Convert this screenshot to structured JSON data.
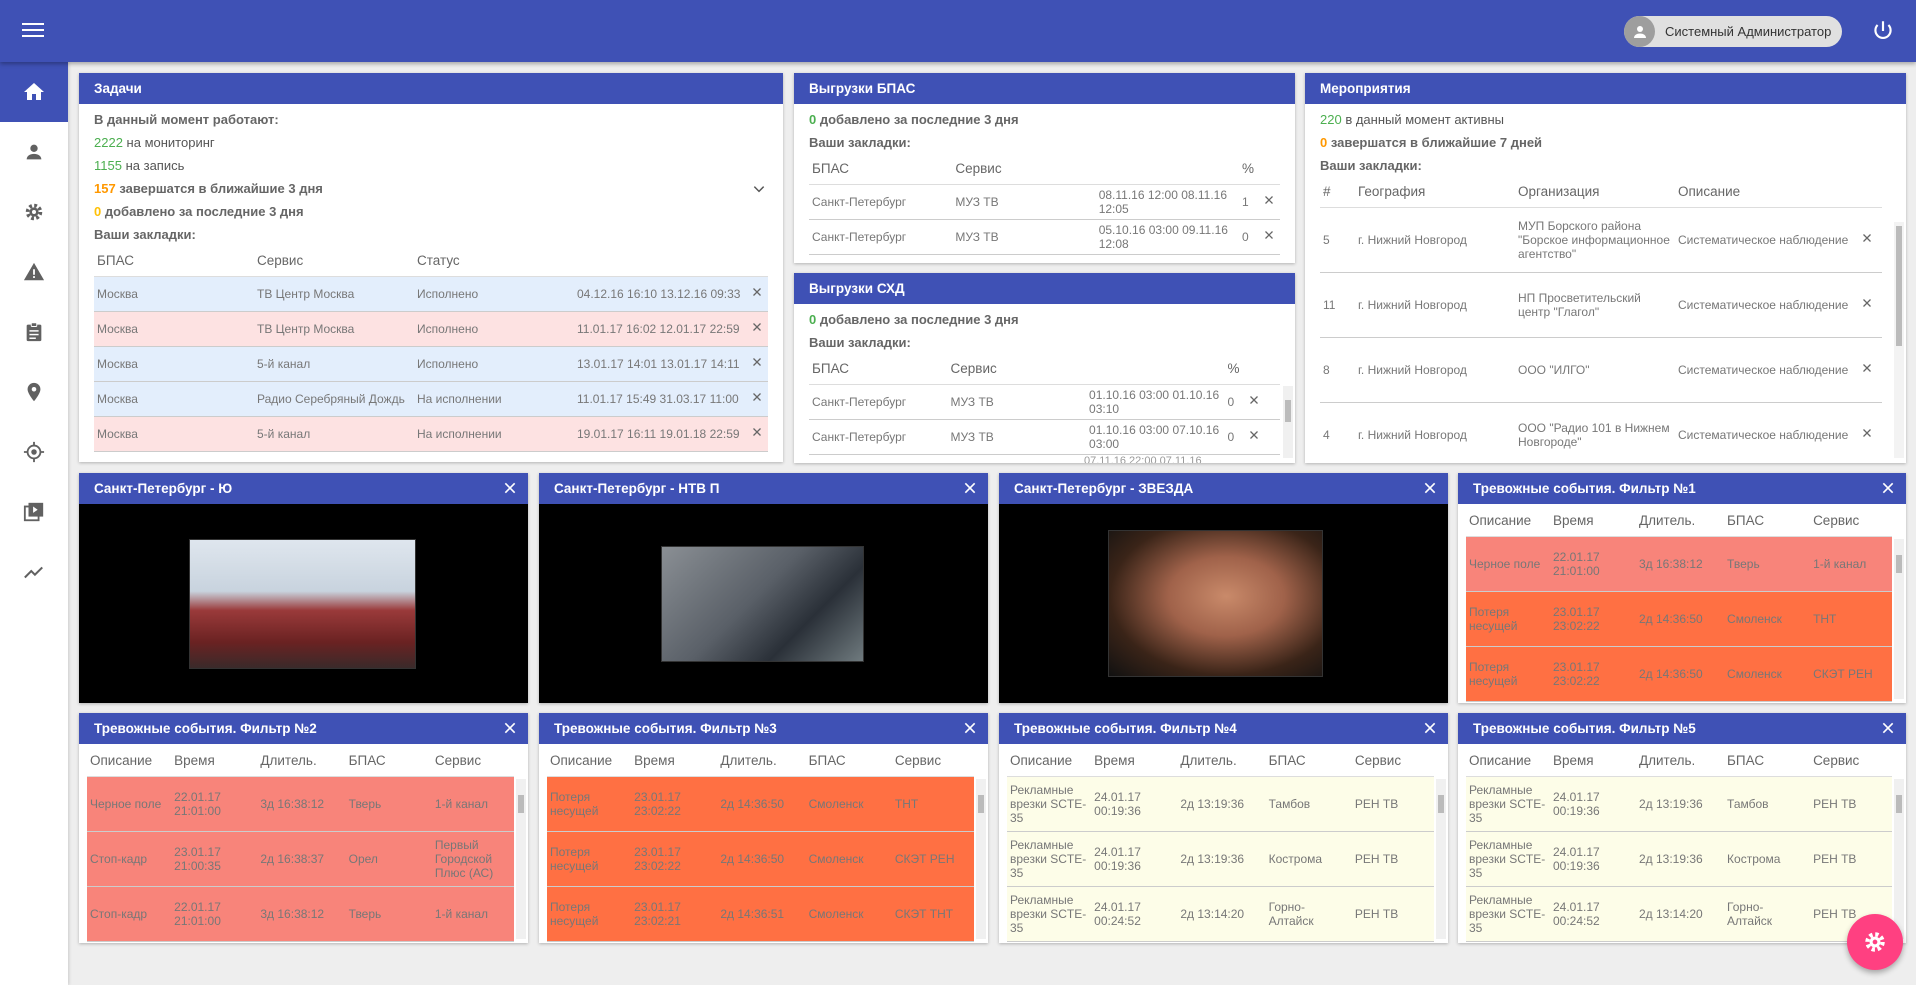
{
  "header": {
    "user_name": "Системный Администратор"
  },
  "sidebar": {
    "items": [
      "home-icon",
      "person-icon",
      "gear-icon",
      "warning-icon",
      "clipboard-icon",
      "location-icon",
      "target-icon",
      "video-icon",
      "trending-icon"
    ]
  },
  "tasks": {
    "title": "Задачи",
    "working_now": "В данный момент работают:",
    "monitoring_count": "2222",
    "monitoring_label": "на мониторинг",
    "record_count": "1155",
    "record_label": "на запись",
    "ending_count": "157",
    "ending_label": "завершатся в ближайшие 3 дня",
    "added_count": "0",
    "added_label": "добавлено за последние 3 дня",
    "bookmarks_label": "Ваши закладки:",
    "columns": [
      "БПАС",
      "Сервис",
      "Статус"
    ],
    "rows": [
      {
        "bpas": "Москва",
        "service": "ТВ Центр Москва",
        "status": "Исполнено",
        "dates": "04.12.16 16:10 13.12.16 09:33",
        "tone": "blue"
      },
      {
        "bpas": "Москва",
        "service": "ТВ Центр Москва",
        "status": "Исполнено",
        "dates": "11.01.17 16:02 12.01.17 22:59",
        "tone": "pink"
      },
      {
        "bpas": "Москва",
        "service": "5-й канал",
        "status": "Исполнено",
        "dates": "13.01.17 14:01 13.01.17 14:11",
        "tone": "blue"
      },
      {
        "bpas": "Москва",
        "service": "Радио Серебряный Дождь",
        "status": "На исполнении",
        "dates": "11.01.17 15:49 31.03.17 11:00",
        "tone": "blue"
      },
      {
        "bpas": "Москва",
        "service": "5-й канал",
        "status": "На исполнении",
        "dates": "19.01.17 16:11 19.01.18 22:59",
        "tone": "pink"
      }
    ]
  },
  "bpas_uploads": {
    "title": "Выгрузки БПАС",
    "added_count": "0",
    "added_label": "добавлено за последние 3 дня",
    "bookmarks_label": "Ваши закладки:",
    "columns": [
      "БПАС",
      "Сервис",
      "",
      "%"
    ],
    "rows": [
      {
        "bpas": "Санкт-Петербург",
        "service": "МУЗ ТВ",
        "dates": "08.11.16 12:00 08.11.16 12:05",
        "pct": "1"
      },
      {
        "bpas": "Санкт-Петербург",
        "service": "МУЗ ТВ",
        "dates": "05.10.16 03:00 09.11.16 12:08",
        "pct": "0"
      }
    ]
  },
  "shd_uploads": {
    "title": "Выгрузки СХД",
    "added_count": "0",
    "added_label": "добавлено за последние 3 дня",
    "bookmarks_label": "Ваши закладки:",
    "columns": [
      "БПАС",
      "Сервис",
      "",
      "%"
    ],
    "rows": [
      {
        "bpas": "Санкт-Петербург",
        "service": "МУЗ ТВ",
        "dates": "01.10.16 03:00 01.10.16 03:10",
        "pct": "0"
      },
      {
        "bpas": "Санкт-Петербург",
        "service": "МУЗ ТВ",
        "dates": "01.10.16 03:00 07.10.16 03:00",
        "pct": "0"
      }
    ],
    "partial_row": "07.11.16 22:00 07.11.16"
  },
  "events": {
    "title": "Мероприятия",
    "active_count": "220",
    "active_label": "в данный момент активны",
    "ending_count": "0",
    "ending_label": "завершатся в ближайшие 7 дней",
    "bookmarks_label": "Ваши закладки:",
    "columns": [
      "#",
      "География",
      "Организация",
      "Описание"
    ],
    "rows": [
      {
        "n": "5",
        "geo": "г. Нижний Новгород",
        "org": "МУП Борского района \"Борское информационное агентство\"",
        "desc": "Систематическое наблюдение"
      },
      {
        "n": "11",
        "geo": "г. Нижний Новгород",
        "org": "НП Просветительский центр \"Глагол\"",
        "desc": "Систематическое наблюдение"
      },
      {
        "n": "8",
        "geo": "г. Нижний Новгород",
        "org": "ООО \"ИЛГО\"",
        "desc": "Систематическое наблюдение"
      },
      {
        "n": "4",
        "geo": "г. Нижний Новгород",
        "org": "ООО \"Радио 101 в Нижнем Новгороде\"",
        "desc": "Систематическое наблюдение"
      }
    ]
  },
  "videos": [
    {
      "title": "Санкт-Петербург - Ю"
    },
    {
      "title": "Санкт-Петербург - НТВ П"
    },
    {
      "title": "Санкт-Петербург - ЗВЕЗДА"
    }
  ],
  "alarm_columns": [
    "Описание",
    "Время",
    "Длитель.",
    "БПАС",
    "Сервис"
  ],
  "alarms": [
    {
      "title": "Тревожные события. Фильтр №1",
      "rows": [
        {
          "d": "Черное поле",
          "t": "22.01.17 21:01:00",
          "dur": "3д 16:38:12",
          "b": "Тверь",
          "s": "1-й канал",
          "tone": "red"
        },
        {
          "d": "Потеря несущей",
          "t": "23.01.17 23:02:22",
          "dur": "2д 14:36:50",
          "b": "Смоленск",
          "s": "ТНТ",
          "tone": "org"
        },
        {
          "d": "Потеря несущей",
          "t": "23.01.17 23:02:22",
          "dur": "2д 14:36:50",
          "b": "Смоленск",
          "s": "СКЭТ РЕН",
          "tone": "org"
        }
      ]
    },
    {
      "title": "Тревожные события. Фильтр №2",
      "rows": [
        {
          "d": "Черное поле",
          "t": "22.01.17 21:01:00",
          "dur": "3д 16:38:12",
          "b": "Тверь",
          "s": "1-й канал",
          "tone": "red"
        },
        {
          "d": "Стоп-кадр",
          "t": "23.01.17 21:00:35",
          "dur": "2д 16:38:37",
          "b": "Орел",
          "s": "Первый Городской Плюс (АС)",
          "tone": "red"
        },
        {
          "d": "Стоп-кадр",
          "t": "22.01.17 21:01:00",
          "dur": "3д 16:38:12",
          "b": "Тверь",
          "s": "1-й канал",
          "tone": "red"
        }
      ]
    },
    {
      "title": "Тревожные события. Фильтр №3",
      "rows": [
        {
          "d": "Потеря несущей",
          "t": "23.01.17 23:02:22",
          "dur": "2д 14:36:50",
          "b": "Смоленск",
          "s": "ТНТ",
          "tone": "org"
        },
        {
          "d": "Потеря несущей",
          "t": "23.01.17 23:02:22",
          "dur": "2д 14:36:50",
          "b": "Смоленск",
          "s": "СКЭТ РЕН",
          "tone": "org"
        },
        {
          "d": "Потеря несущей",
          "t": "23.01.17 23:02:21",
          "dur": "2д 14:36:51",
          "b": "Смоленск",
          "s": "СКЭТ ТНТ",
          "tone": "org"
        }
      ]
    },
    {
      "title": "Тревожные события. Фильтр №4",
      "rows": [
        {
          "d": "Рекламные врезки SCTE-35",
          "t": "24.01.17 00:19:36",
          "dur": "2д 13:19:36",
          "b": "Тамбов",
          "s": "РЕН ТВ",
          "tone": "cream"
        },
        {
          "d": "Рекламные врезки SCTE-35",
          "t": "24.01.17 00:19:36",
          "dur": "2д 13:19:36",
          "b": "Кострома",
          "s": "РЕН ТВ",
          "tone": "cream"
        },
        {
          "d": "Рекламные врезки SCTE-35",
          "t": "24.01.17 00:24:52",
          "dur": "2д 13:14:20",
          "b": "Горно-Алтайск",
          "s": "РЕН ТВ",
          "tone": "cream"
        }
      ]
    },
    {
      "title": "Тревожные события. Фильтр №5",
      "rows": [
        {
          "d": "Рекламные врезки SCTE-35",
          "t": "24.01.17 00:19:36",
          "dur": "2д 13:19:36",
          "b": "Тамбов",
          "s": "РЕН ТВ",
          "tone": "cream"
        },
        {
          "d": "Рекламные врезки SCTE-35",
          "t": "24.01.17 00:19:36",
          "dur": "2д 13:19:36",
          "b": "Кострома",
          "s": "РЕН ТВ",
          "tone": "cream"
        },
        {
          "d": "Рекламные врезки SCTE-35",
          "t": "24.01.17 00:24:52",
          "dur": "2д 13:14:20",
          "b": "Горно-Алтайск",
          "s": "РЕН ТВ",
          "tone": "cream"
        }
      ]
    }
  ],
  "colors": {
    "primary": "#3f51b5",
    "accent": "#ff4081",
    "alarm_red": "#f8847a",
    "alarm_orange": "#ff7043",
    "alarm_cream": "#fdfde8"
  }
}
